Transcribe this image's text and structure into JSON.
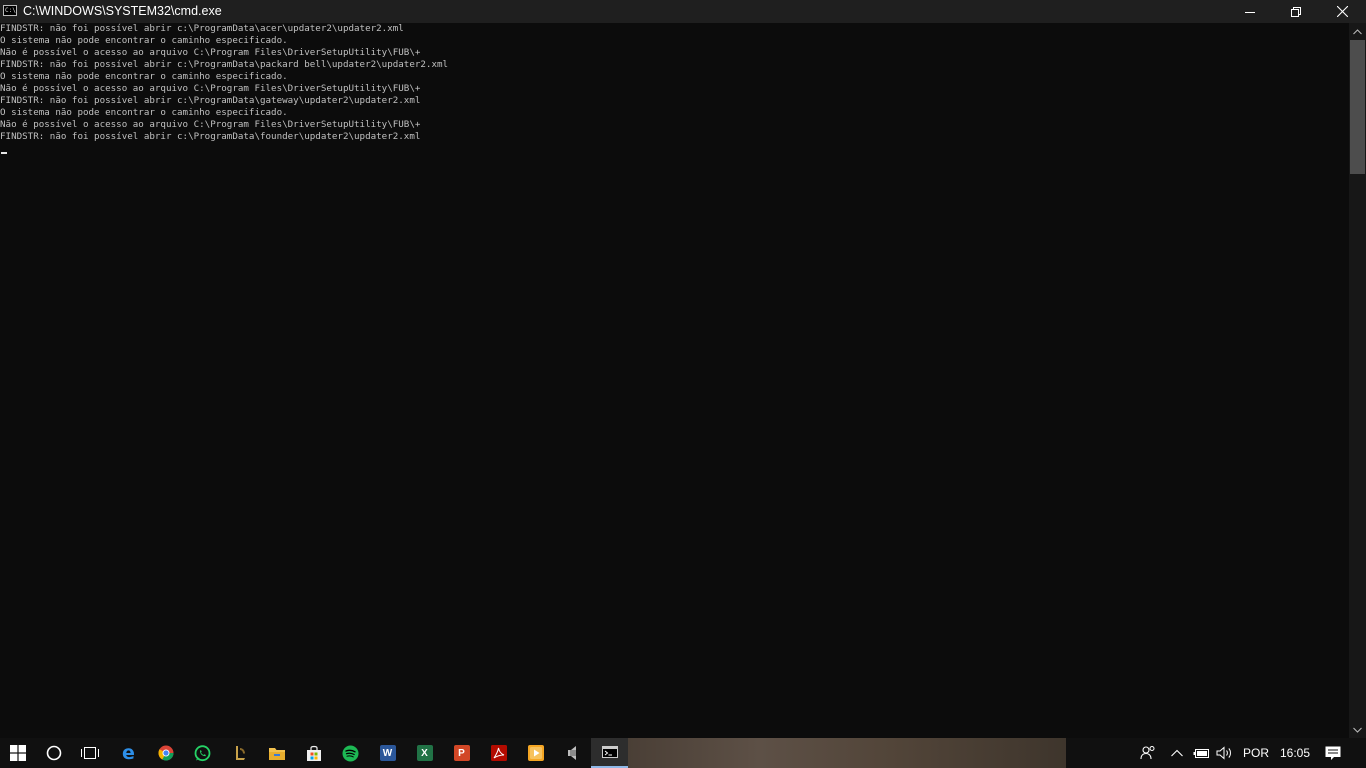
{
  "window": {
    "title": "C:\\WINDOWS\\SYSTEM32\\cmd.exe",
    "icon_text": "C:\\_",
    "icons": {
      "app": "cmd-icon",
      "minimize": "minimize-icon",
      "maximize": "restore-icon",
      "close": "close-icon"
    }
  },
  "console": {
    "lines": [
      "FINDSTR: não foi possível abrir c:\\ProgramData\\acer\\updater2\\updater2.xml",
      "O sistema não pode encontrar o caminho especificado.",
      "Não é possível o acesso ao arquivo C:\\Program Files\\DriverSetupUtility\\FUB\\+",
      "FINDSTR: não foi possível abrir c:\\ProgramData\\packard bell\\updater2\\updater2.xml",
      "O sistema não pode encontrar o caminho especificado.",
      "Não é possível o acesso ao arquivo C:\\Program Files\\DriverSetupUtility\\FUB\\+",
      "FINDSTR: não foi possível abrir c:\\ProgramData\\gateway\\updater2\\updater2.xml",
      "O sistema não pode encontrar o caminho especificado.",
      "Não é possível o acesso ao arquivo C:\\Program Files\\DriverSetupUtility\\FUB\\+",
      "FINDSTR: não foi possível abrir c:\\ProgramData\\founder\\updater2\\updater2.xml"
    ],
    "text_color": "#c0c0c0",
    "background_color": "#0c0c0c"
  },
  "taskbar": {
    "apps": [
      {
        "name": "start-button",
        "icon": "windows-logo-icon"
      },
      {
        "name": "cortana-button",
        "icon": "cortana-circle-icon"
      },
      {
        "name": "task-view-button",
        "icon": "task-view-icon"
      },
      {
        "name": "edge-button",
        "icon": "edge-icon",
        "color": "#1e7fd6",
        "glyph": "e"
      },
      {
        "name": "chrome-button",
        "icon": "chrome-icon",
        "color": "#db4437"
      },
      {
        "name": "whatsapp-button",
        "icon": "whatsapp-icon",
        "color": "#25d366"
      },
      {
        "name": "app-button-7",
        "icon": "game-launcher-icon",
        "color": "#c8a24a"
      },
      {
        "name": "file-explorer-button",
        "icon": "folder-icon",
        "color": "#f2c14e"
      },
      {
        "name": "store-button",
        "icon": "store-bag-icon",
        "color": "#f0f0f0"
      },
      {
        "name": "spotify-button",
        "icon": "spotify-icon",
        "color": "#1db954"
      },
      {
        "name": "word-button",
        "icon": "word-icon",
        "color": "#2b579a",
        "glyph": "W"
      },
      {
        "name": "excel-button",
        "icon": "excel-icon",
        "color": "#217346",
        "glyph": "X"
      },
      {
        "name": "powerpoint-button",
        "icon": "powerpoint-icon",
        "color": "#d24726",
        "glyph": "P"
      },
      {
        "name": "acrobat-button",
        "icon": "acrobat-icon",
        "color": "#b30b00"
      },
      {
        "name": "media-player-button",
        "icon": "media-player-icon",
        "color": "#f5a623"
      },
      {
        "name": "audio-app-button",
        "icon": "speaker-app-icon",
        "color": "#bdbdbd"
      },
      {
        "name": "cmd-taskbar-button",
        "icon": "cmd-icon",
        "color": "#cccccc",
        "active": true
      }
    ],
    "tray": {
      "language": "POR",
      "time": "16:05",
      "icons": [
        "people-icon",
        "chevron-up-icon",
        "battery-icon",
        "volume-icon",
        "action-center-icon"
      ]
    }
  }
}
